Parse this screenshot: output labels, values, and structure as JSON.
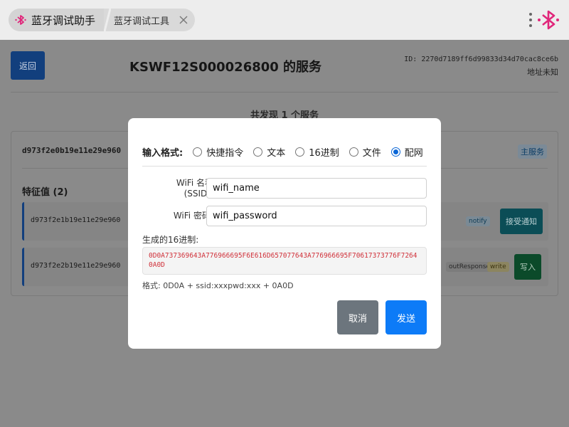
{
  "tabs": {
    "active_title": "蓝牙调试助手",
    "second_label": "蓝牙调试工具"
  },
  "colors": {
    "brand": "#e0267a",
    "primary": "#0d7bf7",
    "secondary": "#6c757d"
  },
  "page": {
    "back_label": "返回",
    "title": "KSWF12S000026800 的服务",
    "device_id": "ID: 2270d7189ff6d99833d34d70cac8ce6b",
    "device_address": "地址未知",
    "found_services": "共发现 1 个服务",
    "service": {
      "uuid": "d973f2e0b19e11e29e960",
      "badge": "主服务",
      "characteristics_title": "特征值 (2)",
      "characteristics": [
        {
          "uuid": "d973f2e1b19e11e29e960",
          "props": [
            "notify"
          ],
          "action": "接受通知"
        },
        {
          "uuid": "d973f2e2b19e11e29e960",
          "props": [
            "outResponse",
            "write"
          ],
          "action": "写入"
        }
      ]
    }
  },
  "modal": {
    "format_label": "输入格式:",
    "formats": [
      {
        "label": "快捷指令",
        "checked": false
      },
      {
        "label": "文本",
        "checked": false
      },
      {
        "label": "16进制",
        "checked": false
      },
      {
        "label": "文件",
        "checked": false
      },
      {
        "label": "配网",
        "checked": true
      }
    ],
    "wifi_name_label_1": "WiFi 名称",
    "wifi_name_label_2": "(SSID):",
    "wifi_name_value": "wifi_name",
    "wifi_pwd_label": "WiFi 密码:",
    "wifi_pwd_value": "wifi_password",
    "hex_label": "生成的16进制:",
    "hex_value": "0D0A737369643A776966695F6E616D657077643A776966695F70617373776F72640A0D",
    "format_hint": "格式: 0D0A + ssid:xxxpwd:xxx + 0A0D",
    "cancel_label": "取消",
    "send_label": "发送"
  }
}
